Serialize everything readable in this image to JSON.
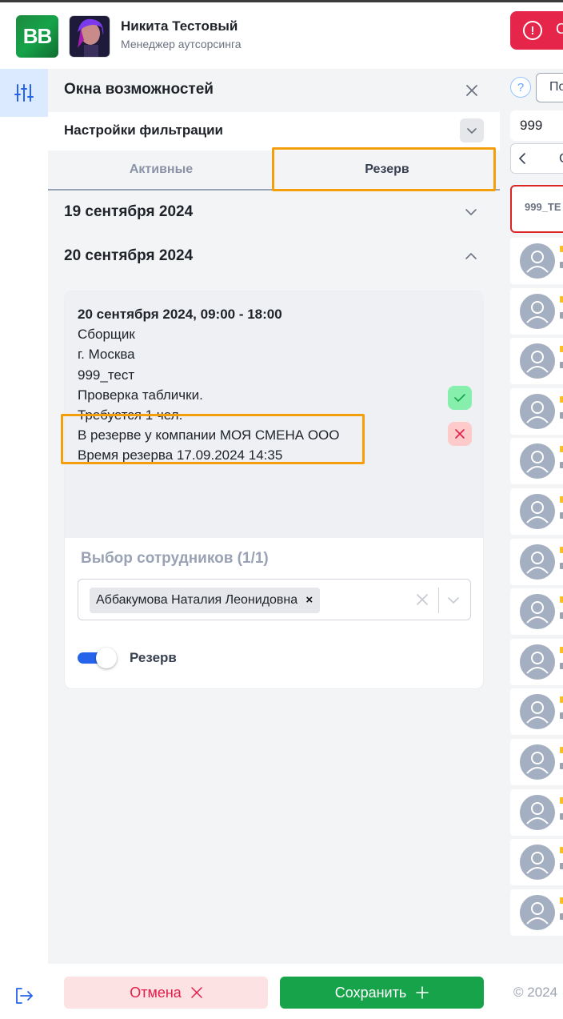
{
  "header": {
    "logo_text": "BB",
    "user_name": "Никита Тестовый",
    "user_role": "Менеджер аутсорсинга",
    "alert_icon": "exclamation-icon",
    "alert_label": "С"
  },
  "panel": {
    "title": "Окна возможностей",
    "filter_label": "Настройки фильтрации",
    "tabs": [
      {
        "label": "Активные",
        "active": false
      },
      {
        "label": "Резерв",
        "active": true
      }
    ],
    "dates": [
      {
        "label": "19 сентября 2024",
        "expanded": false
      },
      {
        "label": "20 сентября 2024",
        "expanded": true
      }
    ]
  },
  "card": {
    "datetime": "20 сентября 2024, 09:00 - 18:00",
    "position": "Сборщик",
    "city": "г. Москва",
    "object": "999_тест",
    "comment": "Проверка таблички.",
    "required": "Требуется 1 чел.",
    "reserved_by": "В резерве у компании МОЯ СМЕНА ООО",
    "reserve_time": "Время резерва 17.09.2024 14:35",
    "employees_title": "Выбор сотрудников (1/1)",
    "selected_employee": "Аббакумова Наталия Леонидовна",
    "chip_remove": "×",
    "reserve_toggle_label": "Резерв",
    "reserve_toggle_on": true
  },
  "footer": {
    "cancel_label": "Отмена",
    "save_label": "Сохранить",
    "copyright": "© 2024"
  },
  "right": {
    "help_label": "?",
    "button_label": "По",
    "search_value": "999",
    "nav_label": "С",
    "selected_card_label": "999_ТЕ",
    "person_count": 14
  },
  "colors": {
    "accent": "#2563eb",
    "danger": "#e5254a",
    "success": "#16a34a",
    "highlight": "#f59e0b"
  }
}
